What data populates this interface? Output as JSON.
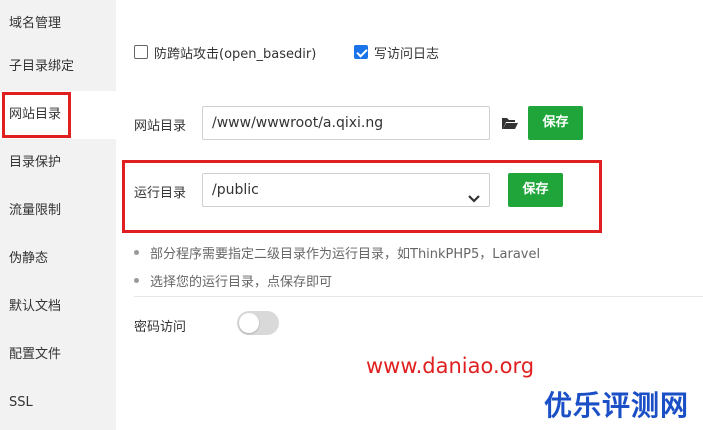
{
  "sidebar": {
    "items": [
      {
        "label": "域名管理"
      },
      {
        "label": "子目录绑定"
      },
      {
        "label": "网站目录"
      },
      {
        "label": "目录保护"
      },
      {
        "label": "流量限制"
      },
      {
        "label": "伪静态"
      },
      {
        "label": "默认文档"
      },
      {
        "label": "配置文件"
      },
      {
        "label": "SSL"
      }
    ],
    "active_index": 2
  },
  "options": {
    "open_basedir": {
      "label": "防跨站攻击(open_basedir)",
      "checked": false
    },
    "access_log": {
      "label": "写访问日志",
      "checked": true
    }
  },
  "site_dir": {
    "label": "网站目录",
    "value": "/www/wwwroot/a.qixi.ng",
    "save_label": "保存",
    "folder_icon": "folder-open-icon"
  },
  "run_dir": {
    "label": "运行目录",
    "selected": "/public",
    "save_label": "保存"
  },
  "tips": [
    "部分程序需要指定二级目录作为运行目录，如ThinkPHP5，Laravel",
    "选择您的运行目录，点保存即可"
  ],
  "password_access": {
    "label": "密码访问",
    "enabled": false
  },
  "watermark": {
    "url": "www.daniao.org",
    "brand": "优乐评测网"
  },
  "colors": {
    "accent_green": "#20a53a",
    "highlight_red": "#e02020",
    "checkbox_blue": "#1a73e8"
  }
}
